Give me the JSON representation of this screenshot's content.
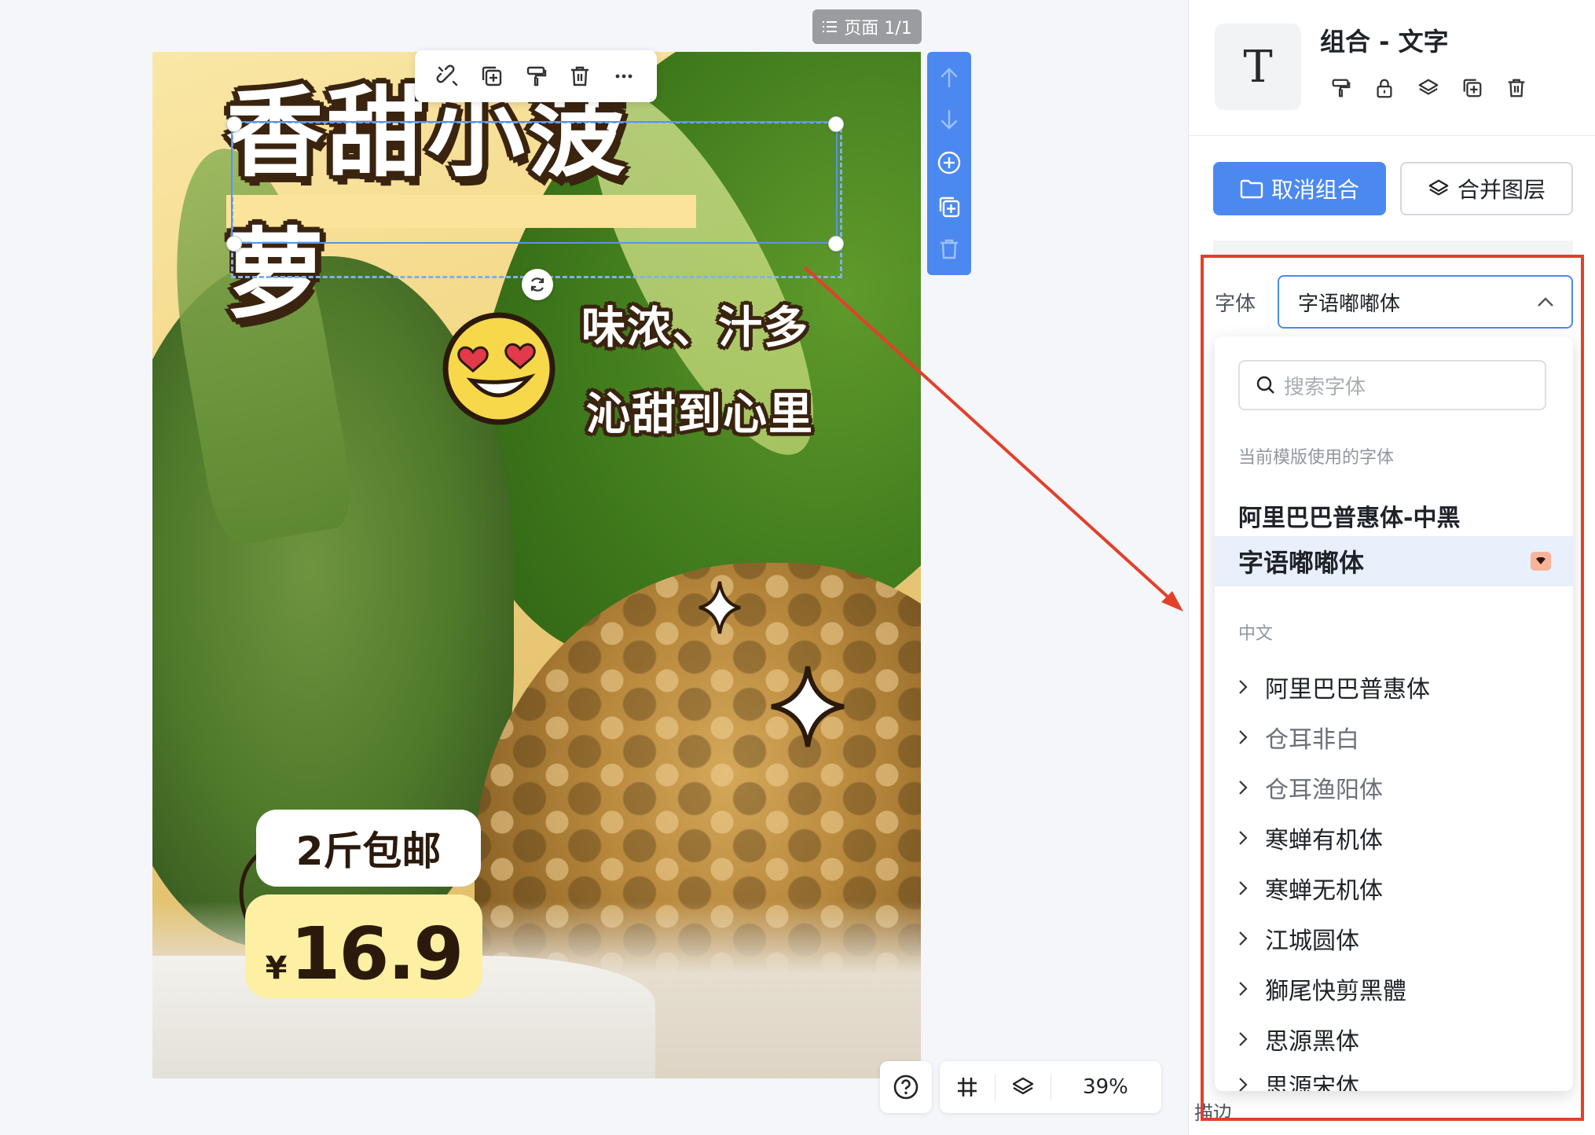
{
  "page_badge": {
    "label": "页面 1/1"
  },
  "canvas": {
    "title": "香甜小菠萝",
    "subtitle_line1": "味浓、汁多",
    "subtitle_line2": "沁甜到心里",
    "tag_text": "2斤包邮",
    "price_currency": "¥",
    "price_value": "16.9"
  },
  "float_toolbar": {
    "icons": [
      "unlink-icon",
      "duplicate-icon",
      "format-painter-icon",
      "delete-icon",
      "more-icon"
    ]
  },
  "side_toolbar": {
    "icons": [
      "move-up-icon",
      "move-down-icon",
      "add-icon",
      "copy-icon",
      "delete-icon"
    ]
  },
  "bottom_toolbar": {
    "zoom": "39%"
  },
  "panel": {
    "thumb_glyph": "T",
    "title": "组合 - 文字",
    "ungroup_label": "取消组合",
    "merge_label": "合并图层",
    "font_label": "字体",
    "font_value": "字语嘟嘟体",
    "search_placeholder": "搜索字体",
    "template_fonts_header": "当前模版使用的字体",
    "template_fonts": [
      "阿里巴巴普惠体-中黑",
      "字语嘟嘟体"
    ],
    "chinese_header": "中文",
    "chinese_fonts": [
      "阿里巴巴普惠体",
      "仓耳非白",
      "仓耳渔阳体",
      "寒蝉有机体",
      "寒蝉无机体",
      "江城圆体",
      "獅尾快剪黑體",
      "思源黑体",
      "思源宋体"
    ],
    "bottom_peek": "描边"
  },
  "colors": {
    "accent": "#4b89f0",
    "annotation": "#e2402b",
    "title_outline": "#3a2410"
  }
}
